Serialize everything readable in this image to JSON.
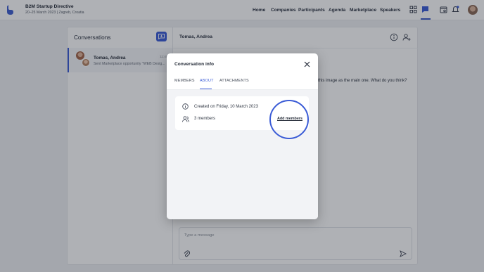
{
  "header": {
    "brand_title": "B2M Startup Directive",
    "brand_subtitle": "20–25 March 2023 | Zagreb, Croatia",
    "nav": [
      "Home",
      "Companies",
      "Participants",
      "Agenda",
      "Marketplace",
      "Speakers"
    ],
    "icons": [
      "grid-icon",
      "chat-icon",
      "calendar-icon",
      "bell-icon",
      "avatar"
    ],
    "accent_color": "#3a5bd6"
  },
  "conversations": {
    "title": "Conversations",
    "items": [
      {
        "name": "Tomas, Andrea",
        "preview": "Sent Marketplace opportunity \"WEB Desig...",
        "time": "11:45"
      }
    ]
  },
  "chat": {
    "title": "Tomas, Andrea",
    "message_fragment": "this image as the main one. What do you think?",
    "composer_placeholder": "Type a message"
  },
  "modal": {
    "title": "Conversation info",
    "tabs": [
      {
        "label": "MEMBERS",
        "active": false
      },
      {
        "label": "ABOUT",
        "active": true
      },
      {
        "label": "ATTACHMENTS",
        "active": false
      }
    ],
    "created": "Created on Friday, 10 March 2023",
    "members": "3 members",
    "add_members": "Add members"
  }
}
